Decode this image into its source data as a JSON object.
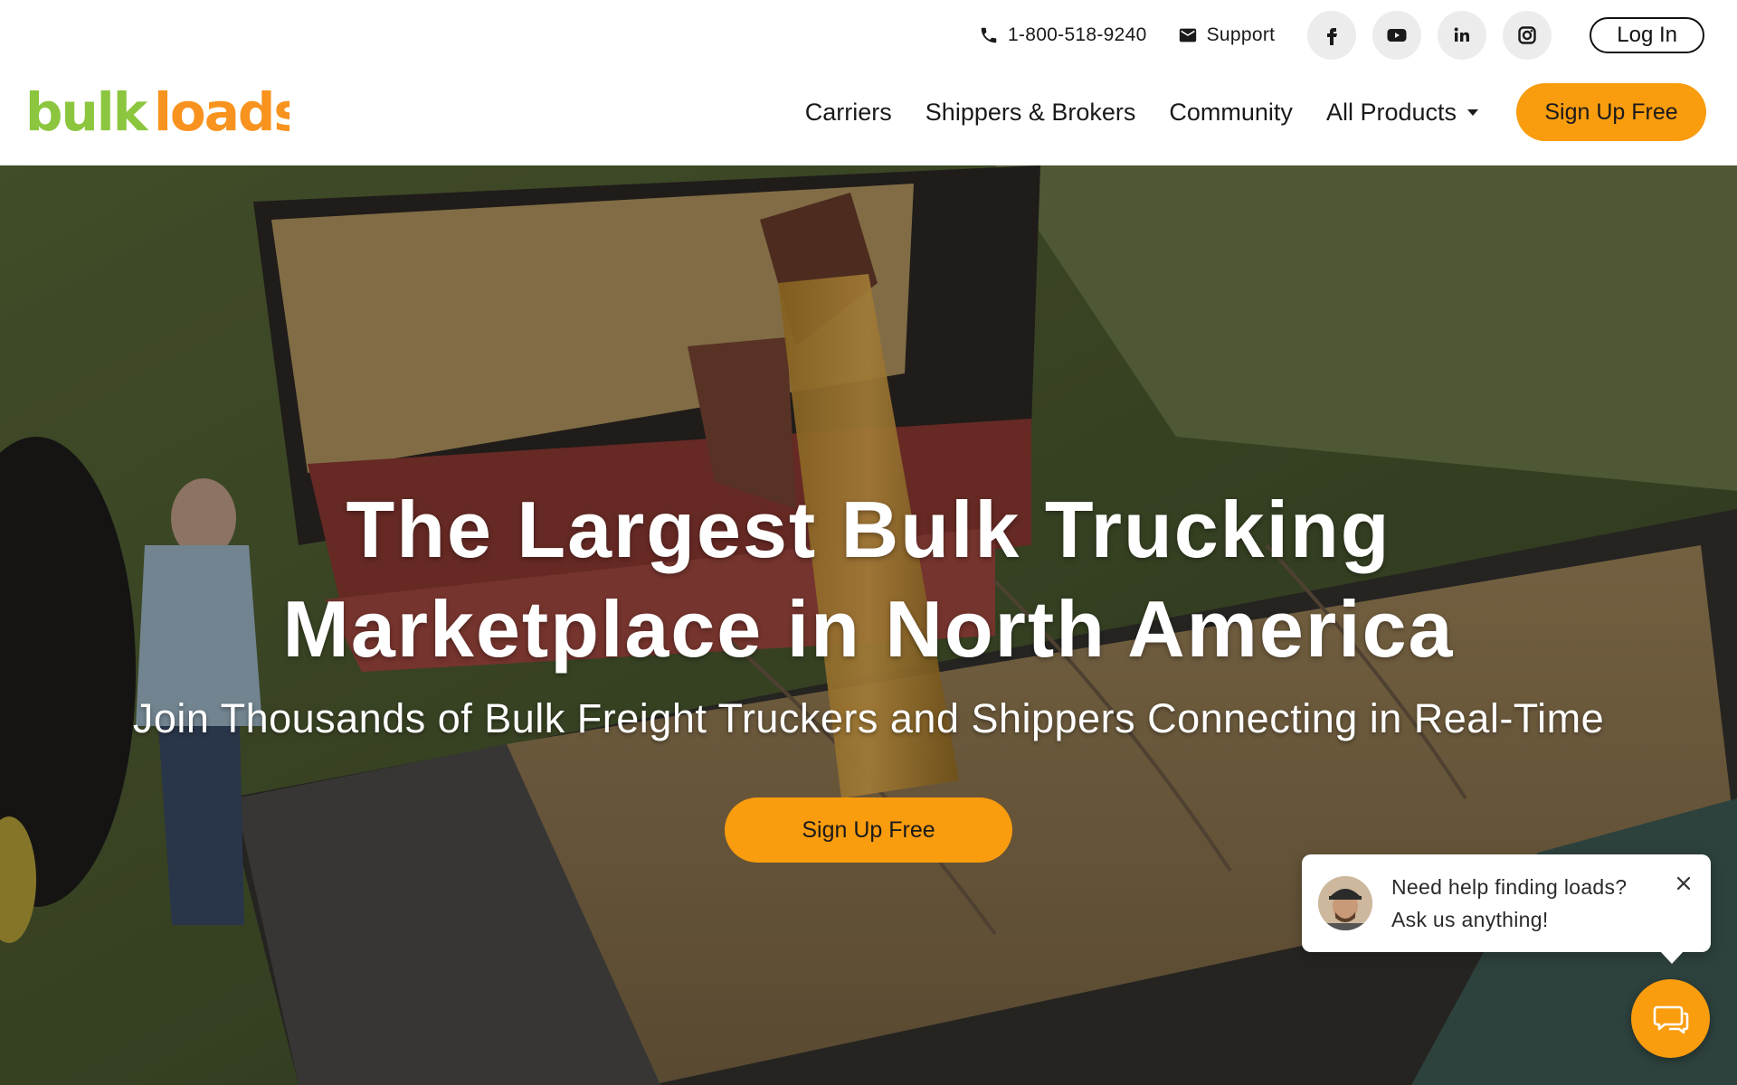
{
  "header": {
    "phone": "1-800-518-9240",
    "support_label": "Support",
    "social_icons": [
      "facebook-icon",
      "youtube-icon",
      "linkedin-icon",
      "instagram-icon"
    ],
    "login_label": "Log In",
    "logo_text_green": "bulk",
    "logo_text_orange": "loads",
    "nav": {
      "carriers": "Carriers",
      "shippers": "Shippers & Brokers",
      "community": "Community",
      "all_products": "All Products"
    },
    "signup_label": "Sign Up Free"
  },
  "hero": {
    "title_line1": "The Largest Bulk Trucking",
    "title_line2": "Marketplace in North America",
    "subtitle": "Join Thousands of Bulk Freight Truckers and Shippers Connecting in Real-Time",
    "cta_label": "Sign Up Free"
  },
  "chat": {
    "line1": "Need help finding loads?",
    "line2": "Ask us anything!"
  },
  "colors": {
    "accent_orange": "#f99c0e",
    "logo_green": "#8cc63f",
    "logo_orange": "#f7931e"
  }
}
